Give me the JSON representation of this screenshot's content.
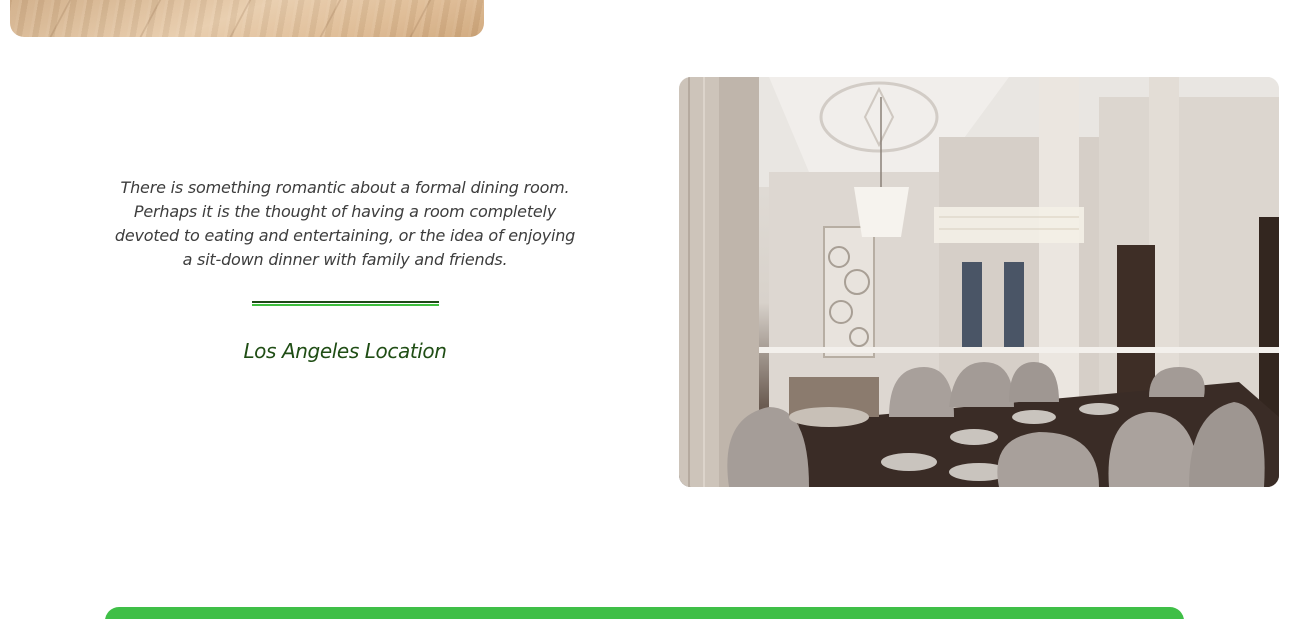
{
  "section": {
    "quote": "There is something romantic about a formal dining room. Perhaps it is the thought of having a room completely devoted to eating and entertaining, or the idea of enjoying a sit-down dinner with family and friends.",
    "location_title": "Los Angeles Location"
  },
  "images": {
    "top": "wood-floor-photo",
    "main": "formal-dining-room-photo"
  },
  "colors": {
    "accent_green": "#3fbf47",
    "dark_green": "#1f4d14",
    "text_gray": "#3d3d3d"
  }
}
